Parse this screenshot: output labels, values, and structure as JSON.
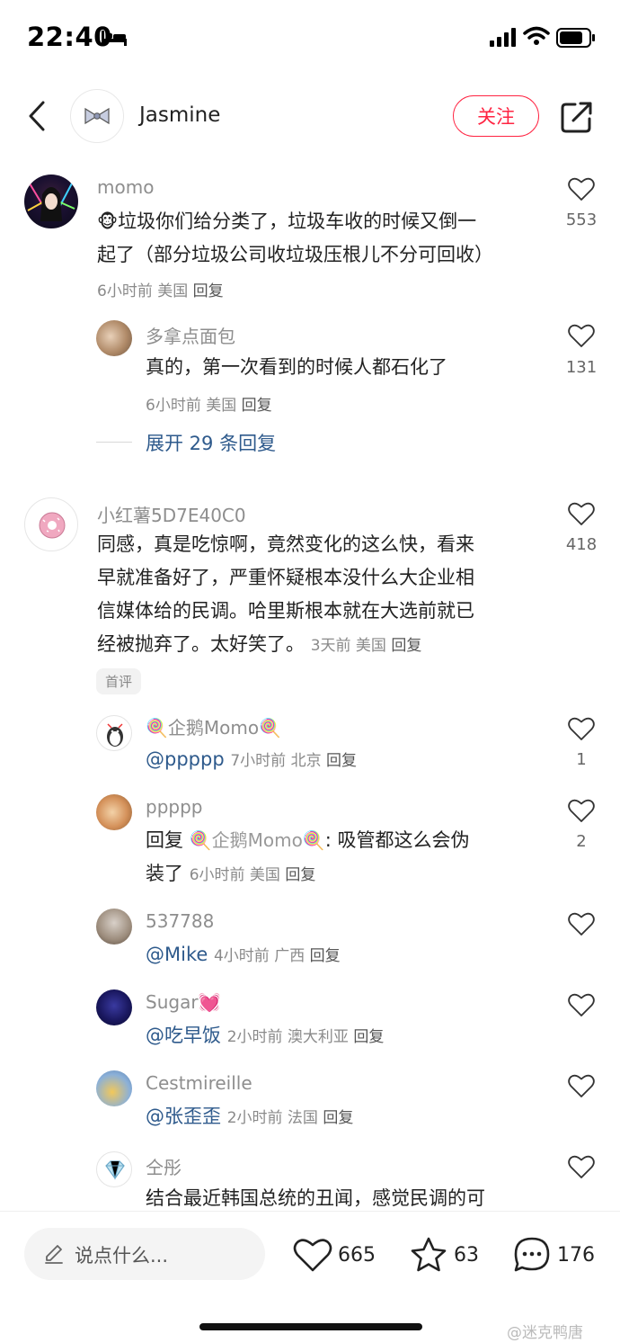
{
  "status_bar": {
    "time": "22:40"
  },
  "header": {
    "name": "Jasmine",
    "follow_label": "关注"
  },
  "comments": [
    {
      "name": "momo",
      "emoji": "🐵",
      "text_lines": [
        "垃圾你们给分类了，垃圾车收的时候又倒一",
        "起了（部分垃圾公司收垃圾压根儿不分可回收）"
      ],
      "time": "6小时前",
      "location": "美国",
      "reply": "回复",
      "likes": "553"
    },
    {
      "name": "多拿点面包",
      "text": "真的，第一次看到的时候人都石化了",
      "time": "6小时前",
      "location": "美国",
      "reply": "回复",
      "likes": "131"
    },
    {
      "expand_label": "展开 29 条回复"
    },
    {
      "name": "小红薯5D7E40C0",
      "text_lines": [
        "同感，真是吃惊啊，竟然变化的这么快，看来",
        "早就准备好了，严重怀疑根本没什么大企业相",
        "信媒体给的民调。哈里斯根本就在大选前就已",
        "经被抛弃了。太好笑了。"
      ],
      "time": "3天前",
      "location": "美国",
      "reply": "回复",
      "likes": "418",
      "tag": "首评"
    },
    {
      "name": "企鹅Momo",
      "emoji": "🍭",
      "mention": "@ppppp",
      "time": "7小时前",
      "location": "北京",
      "reply": "回复",
      "likes": "1"
    },
    {
      "name": "ppppp",
      "text_prefix": "回复 ",
      "reply_to": "企鹅Momo",
      "text_suffix": ": 吸管都这么会伪",
      "text_line2": "装了",
      "time": "6小时前",
      "location": "美国",
      "reply": "回复",
      "likes": "2"
    },
    {
      "name": "537788",
      "mention": "@Mike",
      "time": "4小时前",
      "location": "广西",
      "reply": "回复"
    },
    {
      "name": "Sugar",
      "emoji": "💓",
      "mention": "@吃早饭",
      "time": "2小时前",
      "location": "澳大利亚",
      "reply": "回复"
    },
    {
      "name": "Cestmireille",
      "mention": "@张歪歪",
      "time": "2小时前",
      "location": "法国",
      "reply": "回复"
    },
    {
      "name": "仝彤",
      "text": "结合最近韩国总统的丑闻，感觉民调的可"
    }
  ],
  "bottom_bar": {
    "placeholder": "说点什么...",
    "likes": "665",
    "stars": "63",
    "comments": "176"
  },
  "watermark": "@迷克鸭唐"
}
